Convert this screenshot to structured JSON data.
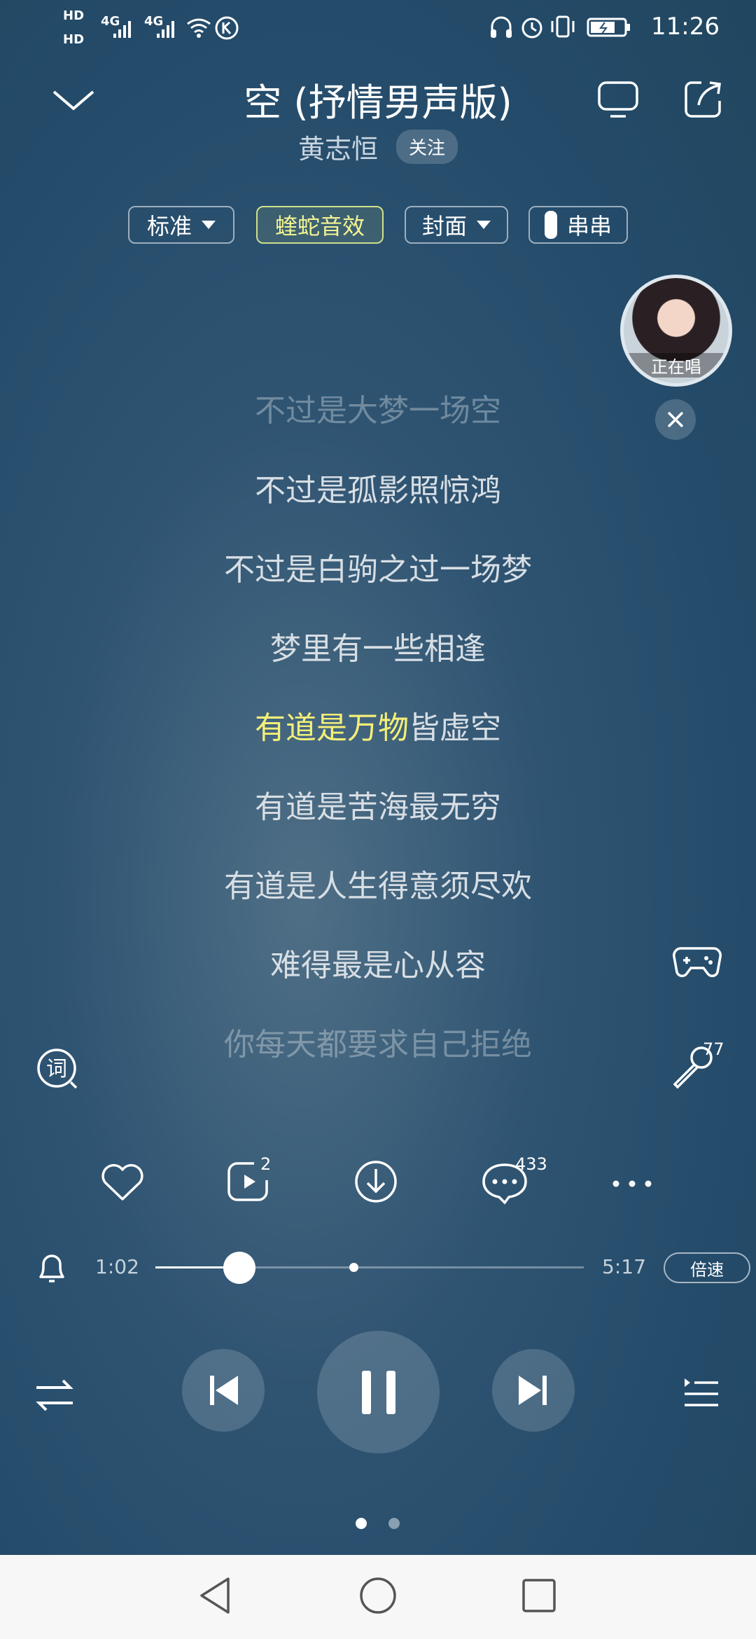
{
  "status_bar": {
    "hd1": "HD",
    "hd2": "HD",
    "net1": "4G",
    "net2": "4G",
    "time": "11:26"
  },
  "header": {
    "title": "空 (抒情男声版)",
    "artist": "黄志恒",
    "follow_label": "关注"
  },
  "chips": [
    {
      "label": "标准",
      "dropdown": true,
      "active": false
    },
    {
      "label": "蝰蛇音效",
      "dropdown": false,
      "active": true
    },
    {
      "label": "封面",
      "dropdown": true,
      "active": false
    },
    {
      "label": "串串",
      "toggle": true,
      "active": false
    }
  ],
  "singer_bubble": {
    "label": "正在唱"
  },
  "lyrics": {
    "lines": [
      "不过是大梦一场空",
      "不过是孤影照惊鸿",
      "不过是白驹之过一场梦",
      "梦里有一些相逢",
      "有道是万物皆虚空",
      "有道是苦海最无穷",
      "有道是人生得意须尽欢",
      "难得最是心从容",
      "你每天都要求自己拒绝"
    ],
    "current_highlight": "有道是万物",
    "current_rest": "皆虚空"
  },
  "side": {
    "mic_count": "77"
  },
  "actions": {
    "video_count": "2",
    "comment_count": "433"
  },
  "progress": {
    "elapsed": "1:02",
    "total": "5:17",
    "fraction": 0.196,
    "speed_label": "倍速"
  },
  "pager": {
    "pages": 2,
    "active": 0
  },
  "colors": {
    "highlight": "#f4ef78",
    "background": "#2a4f6e",
    "chip_active": "#f3f592"
  }
}
